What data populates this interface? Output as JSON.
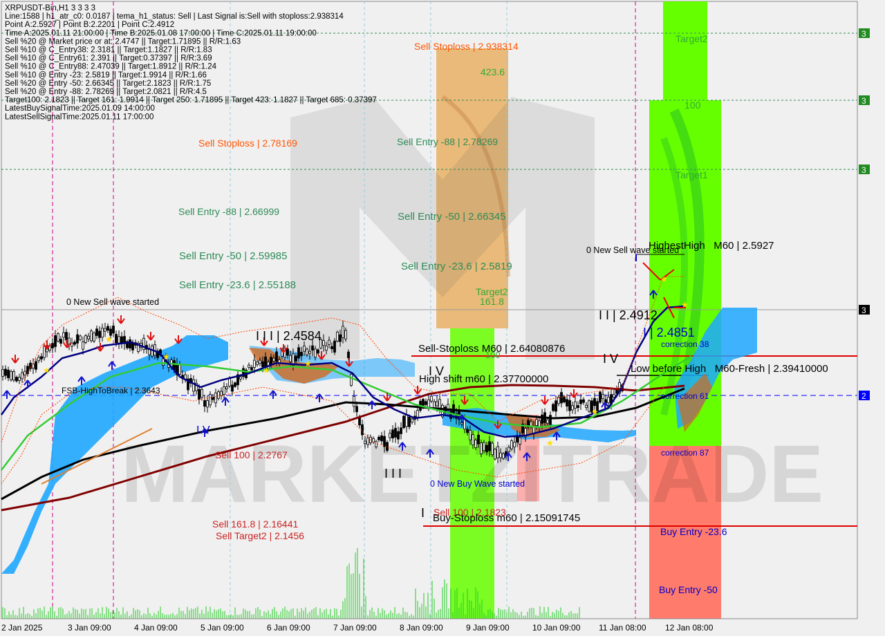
{
  "info_lines": [
    "XRPUSDT-Bin,H1  3 3 3 3",
    "Line:1588 | h1_atr_c0: 0.0187 | tema_h1_status: Sell | Last Signal is:Sell with stoploss:2.938314",
    "Point A:2.5927 | Point B:2.2201 | Point C:2.4912",
    "Time A:2025.01.11 21:00:00 | Time B:2025.01.08 17:00:00 | Time C:2025.01.11 19:00:00",
    "Sell %20 @ Market price or at: 2.4747 || Target:1.71895 || R/R:1.63",
    "Sell %10 @ C_Entry38: 2.3181 || Target:1.1827 || R/R:1.83",
    "Sell %10 @ C_Entry61: 2.391 || Target:0.37397 || R/R:3.69",
    "Sell %10 @ C_Entry88: 2.47039 || Target:1.8912 || R/R:1.24",
    "Sell %10 @ Entry -23: 2.5819 || Target:1.9914 || R/R:1.66",
    "Sell %20 @ Entry -50: 2.66345 || Target:2.1823 || R/R:1.75",
    "Sell %20 @ Entry -88: 2.78269 || Target:2.0821 || R/R:4.5",
    "Target100: 2.1823 || Target 161: 1.9914 || Target 250: 1.71895 || Target 423: 1.1827 || Target 685: 0.37397",
    "LatestBuySignalTime:2025.01.09 14:00:00",
    "LatestSellSignalTime:2025.01.11 17:00:00"
  ],
  "chart_labels": [
    {
      "text": "Sell Stoploss | 2.938314",
      "color": "#ff5500"
    },
    {
      "text": "423.6",
      "color": "#33aa33"
    },
    {
      "text": "Sell Entry -88 | 2.78269",
      "color": "#2e8b57"
    },
    {
      "text": "Sell Stoploss | 2.78169",
      "color": "#ff5500"
    },
    {
      "text": "Sell Entry -88 | 2.66999",
      "color": "#2e8b57"
    },
    {
      "text": "Sell Entry -50 | 2.66345",
      "color": "#2e8b57"
    },
    {
      "text": "Sell Entry -50 | 2.59985",
      "color": "#2e8b57"
    },
    {
      "text": "Sell Entry -23.6 | 2.5819",
      "color": "#2e8b57"
    },
    {
      "text": "Sell Entry -23.6 | 2.55188",
      "color": "#2e8b57"
    },
    {
      "text": "Target2",
      "color": "#33aa33"
    },
    {
      "text": "161.8",
      "color": "#33aa33"
    },
    {
      "text": "0 New Sell wave started",
      "color": "#000000"
    },
    {
      "text": "0 New Sell wave started",
      "color": "#000000"
    },
    {
      "text": "HighestHigh   M60 | 2.5927",
      "color": "#000000"
    },
    {
      "text": "I I | 2.4912",
      "color": "#000000"
    },
    {
      "text": "I I I | 2.4584",
      "color": "#000000"
    },
    {
      "text": "I | 2.4851",
      "color": "#0000cc"
    },
    {
      "text": "correction 38",
      "color": "#0000cc"
    },
    {
      "text": "Sell-Stoploss M60 | 2.64080876",
      "color": "#000000"
    },
    {
      "text": "100",
      "color": "#33aa33"
    },
    {
      "text": "I V",
      "color": "#000000"
    },
    {
      "text": "I V",
      "color": "#000000"
    },
    {
      "text": "Low before High   M60-Fresh | 2.39410000",
      "color": "#000000"
    },
    {
      "text": "High shift m60 | 2.37700000",
      "color": "#000000"
    },
    {
      "text": "FSB-HighToBreak | 2.3643",
      "color": "#000000"
    },
    {
      "text": "correction 61",
      "color": "#0000cc"
    },
    {
      "text": "I V",
      "color": "#0000cc"
    },
    {
      "text": "Sell 100 | 2.2767",
      "color": "#cc2222"
    },
    {
      "text": "correction 87",
      "color": "#0000cc"
    },
    {
      "text": "I I I",
      "color": "#000000"
    },
    {
      "text": "0 New Buy Wave started",
      "color": "#0000cc"
    },
    {
      "text": "Sell 100 | 2.1823",
      "color": "#cc2222"
    },
    {
      "text": "I",
      "color": "#000000"
    },
    {
      "text": "Buy-Stoploss m60 | 2.15091745",
      "color": "#000000"
    },
    {
      "text": "Sell 161.8 | 2.16441",
      "color": "#cc2222"
    },
    {
      "text": "Sell Target2 | 2.1456",
      "color": "#cc2222"
    },
    {
      "text": "Buy Entry -23.6",
      "color": "#0000cc"
    },
    {
      "text": "Buy Entry -50",
      "color": "#0000cc"
    },
    {
      "text": "Target2",
      "color": "#33aa33"
    },
    {
      "text": "100",
      "color": "#33aa33"
    },
    {
      "text": "Target1",
      "color": "#33aa33"
    }
  ],
  "right_markers": [
    {
      "text": "3",
      "bg": "#228b22"
    },
    {
      "text": "3",
      "bg": "#228b22"
    },
    {
      "text": "3",
      "bg": "#228b22"
    },
    {
      "text": "3",
      "bg": "#000000"
    },
    {
      "text": "2",
      "bg": "#0000ff"
    }
  ],
  "x_axis_labels": [
    "2 Jan 2025",
    "3 Jan 09:00",
    "4 Jan 09:00",
    "5 Jan 09:00",
    "6 Jan 09:00",
    "7 Jan 09:00",
    "8 Jan 09:00",
    "9 Jan 09:00",
    "10 Jan 09:00",
    "11 Jan 08:00",
    "12 Jan 08:00"
  ],
  "watermark": "MARKETZITRADE",
  "colors": {
    "green_zone": "#66ff00",
    "orange_zone": "#e8b46c",
    "red_zone": "#ff7b6b",
    "cloud": "#1ea7ff",
    "cloud_orange": "#d2691e",
    "red_line": "#dd0000",
    "blue_dash": "#0000ff",
    "ma_black": "#000000",
    "ma_maroon": "#800000",
    "ma_green": "#33cc33",
    "ma_navy": "#000080",
    "ma_orange": "#e08030"
  }
}
